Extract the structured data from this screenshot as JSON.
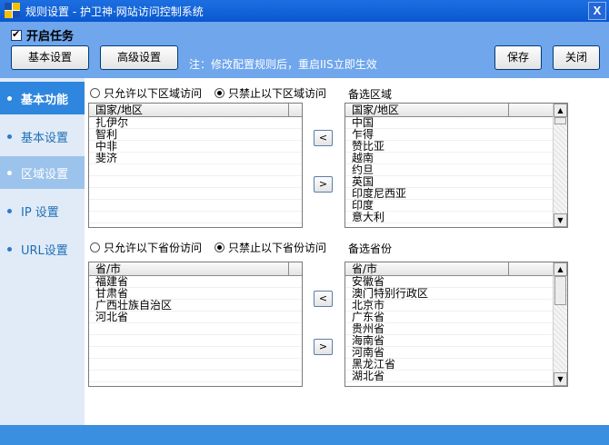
{
  "window": {
    "title": "规则设置 - 护卫神·网站访问控制系统",
    "close_label": "X"
  },
  "toolbar": {
    "task_label": "开启任务",
    "task_checked": true,
    "basic_settings_label": "基本设置",
    "advanced_settings_label": "高级设置",
    "note": "注：修改配置规则后，重启IIS立即生效",
    "save_label": "保存",
    "close_label": "关闭"
  },
  "sidebar": {
    "items": [
      {
        "label": "基本功能",
        "state": "active"
      },
      {
        "label": "基本设置",
        "state": "normal"
      },
      {
        "label": "区域设置",
        "state": "selected"
      },
      {
        "label": "IP 设置",
        "state": "normal"
      },
      {
        "label": "URL设置",
        "state": "normal"
      }
    ]
  },
  "region": {
    "radio_allow": "只允许以下区域访问",
    "radio_deny": "只禁止以下区域访问",
    "selected_mode": "deny",
    "list_header": "国家/地区",
    "selected_items": [
      "扎伊尔",
      "智利",
      "中非",
      "斐济"
    ],
    "candidate_label": "备选区域",
    "candidate_header": "国家/地区",
    "candidate_items": [
      "中国",
      "乍得",
      "赞比亚",
      "越南",
      "约旦",
      "英国",
      "印度尼西亚",
      "印度",
      "意大利"
    ],
    "add_label": "<",
    "remove_label": ">"
  },
  "province": {
    "radio_allow": "只允许以下省份访问",
    "radio_deny": "只禁止以下省份访问",
    "selected_mode": "deny",
    "list_header": "省/市",
    "selected_items": [
      "福建省",
      "甘肃省",
      "广西壮族自治区",
      "河北省"
    ],
    "candidate_label": "备选省份",
    "candidate_header": "省/市",
    "candidate_items": [
      "安徽省",
      "澳门特别行政区",
      "北京市",
      "广东省",
      "贵州省",
      "海南省",
      "河南省",
      "黑龙江省",
      "湖北省"
    ],
    "add_label": "<",
    "remove_label": ">"
  },
  "colors": {
    "title_bar": "#0a58d0",
    "toolbar": "#6fa6ec",
    "sidebar_active": "#2f86de",
    "sidebar_selected": "#9cc3ec",
    "sidebar_text": "#1f6fb8"
  }
}
